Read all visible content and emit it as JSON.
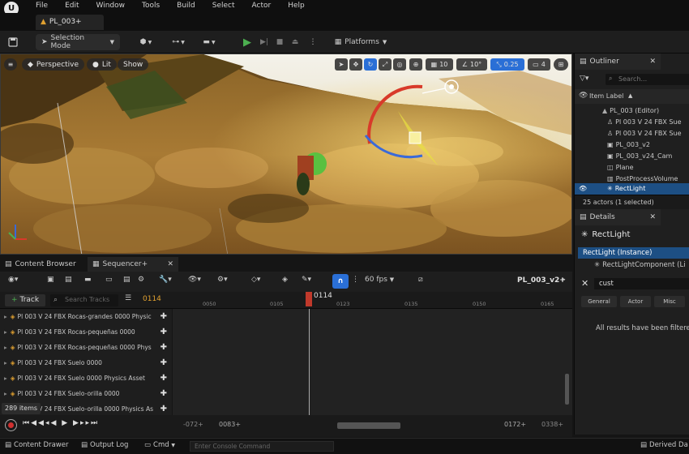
{
  "menubar": {
    "items": [
      "File",
      "Edit",
      "Window",
      "Tools",
      "Build",
      "Select",
      "Actor",
      "Help"
    ]
  },
  "doc_tab": {
    "label": "PL_003+"
  },
  "toolbar": {
    "selection_mode": "Selection Mode",
    "platforms": "Platforms"
  },
  "viewport": {
    "perspective": "Perspective",
    "lit": "Lit",
    "show": "Show",
    "grid_snap": "10",
    "rotation_snap": "10°",
    "scale_snap": "0.25",
    "camera_speed": "4"
  },
  "outliner": {
    "tab": "Outliner",
    "search_placeholder": "Search...",
    "column_label": "Item Label",
    "items": [
      "PL_003 (Editor)",
      "Pl 003 V 24 FBX Sue",
      "Pl 003 V 24 FBX Sue",
      "PL_003_v2",
      "PL_003_v24_Cam",
      "Plane",
      "PostProcessVolume",
      "RectLight"
    ],
    "status": "25 actors (1 selected)"
  },
  "details": {
    "tab": "Details",
    "actor_name": "RectLight",
    "instance": "RectLight (Instance)",
    "component": "RectLightComponent (Li",
    "search_value": "cust",
    "categories": [
      "General",
      "Actor",
      "Misc"
    ],
    "filtered_message": "All results have been filtered"
  },
  "bottom_tabs": {
    "content_browser": "Content Browser",
    "sequencer": "Sequencer+"
  },
  "sequencer": {
    "fps": "60 fps",
    "sequence_name": "PL_003_v2+",
    "add_track": "Track",
    "search_placeholder": "Search Tracks",
    "current_frame": "0114",
    "playhead_label": "0114",
    "ruler_ticks": [
      "0050",
      "0105",
      "0123",
      "0135",
      "0150",
      "0165"
    ],
    "tracks": [
      "Pl 003 V 24 FBX Rocas-grandes 0000 Physic",
      "Pl 003 V 24 FBX Rocas-pequeñas 0000",
      "Pl 003 V 24 FBX Rocas-pequeñas 0000 Phys",
      "Pl 003 V 24 FBX Suelo 0000",
      "Pl 003 V 24 FBX Suelo 0000 Physics Asset",
      "Pl 003 V 24 FBX Suelo-orilla 0000",
      "Pl 003 V 24 FBX Suelo-orilla 0000 Physics As"
    ],
    "items_count": "289 items",
    "range_start": "-072+",
    "view_start": "0083+",
    "view_end": "0172+",
    "range_end": "0338+"
  },
  "statusbar": {
    "content_drawer": "Content Drawer",
    "output_log": "Output Log",
    "cmd": "Cmd",
    "console_placeholder": "Enter Console Command",
    "derived_data": "Derived Da"
  },
  "colors": {
    "accent_blue": "#2a6fd6",
    "selection": "#1d4f84",
    "playhead": "#c0392b",
    "play_green": "#4caf50",
    "frame_orange": "#e0a030"
  }
}
